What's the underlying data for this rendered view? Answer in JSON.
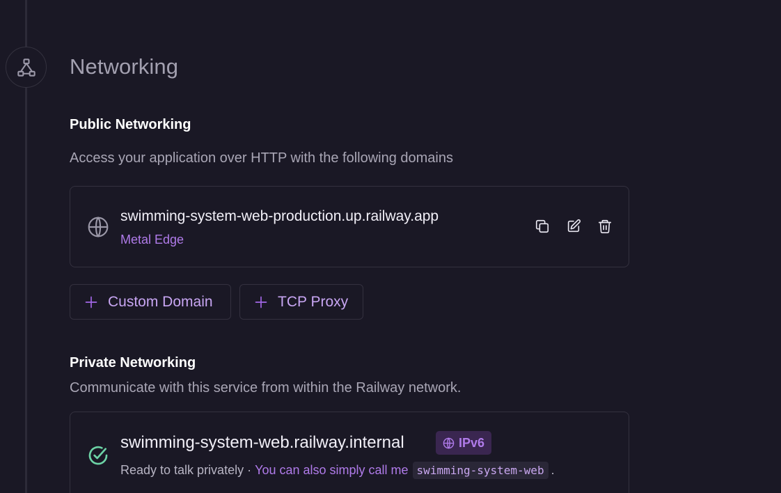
{
  "section": {
    "title": "Networking",
    "icon": "network-icon"
  },
  "public_networking": {
    "heading": "Public Networking",
    "description": "Access your application over HTTP with the following domains",
    "domain": {
      "url": "swimming-system-web-production.up.railway.app",
      "edge_label": "Metal Edge",
      "icons": [
        "globe-icon",
        "copy-icon",
        "edit-icon",
        "delete-icon"
      ]
    },
    "buttons": {
      "custom_domain": "Custom Domain",
      "tcp_proxy": "TCP Proxy"
    }
  },
  "private_networking": {
    "heading": "Private Networking",
    "description": "Communicate with this service from within the Railway network.",
    "internal": {
      "hostname": "swimming-system-web.railway.internal",
      "badge": "IPv6",
      "status": "Ready to talk privately",
      "separator": "·",
      "alias_lead": "You can also simply call me",
      "alias": "swimming-system-web",
      "trailing": "."
    }
  },
  "colors": {
    "background": "#1a1825",
    "accent": "#b07bea",
    "success": "#6dd3a6"
  }
}
